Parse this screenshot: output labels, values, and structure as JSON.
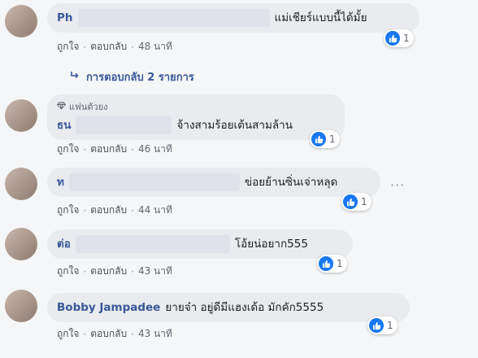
{
  "comments": [
    {
      "name": "Ph",
      "text": "แม่เชียร์แบบนี้ได้มั้ย",
      "like_count": "1",
      "time": "48 นาที"
    },
    {
      "name": "ธน",
      "text": "จ้างสามร้อยเต้นสามล้าน",
      "like_count": "1",
      "time": "46 นาที",
      "badge": "แฟนตัวยง"
    },
    {
      "name": "ท",
      "text": "ข่อยย้านซิ่นเจ่าหลุด",
      "like_count": "1",
      "time": "44 นาที"
    },
    {
      "name": "ต่อ",
      "text": "โอ้ยน่อยาก555",
      "like_count": "1",
      "time": "43 นาที"
    },
    {
      "name": "Bobby Jampadee",
      "text": "ยายจ๋า อยู่ดีมีแฮงเด้อ มักคัก5555",
      "like_count": "1",
      "time": "43 นาที"
    }
  ],
  "actions": {
    "like": "ถูกใจ",
    "reply": "ตอบกลับ",
    "sep": "·"
  },
  "replies_link": "การตอบกลับ 2 รายการ",
  "more_glyph": "···",
  "colors": {
    "link": "#385898",
    "like_blue": "#1877f2",
    "bubble": "#e9ebee"
  },
  "icons": [
    "like-thumb-icon",
    "diamond-icon",
    "reply-arrow-icon",
    "more-options-icon"
  ]
}
